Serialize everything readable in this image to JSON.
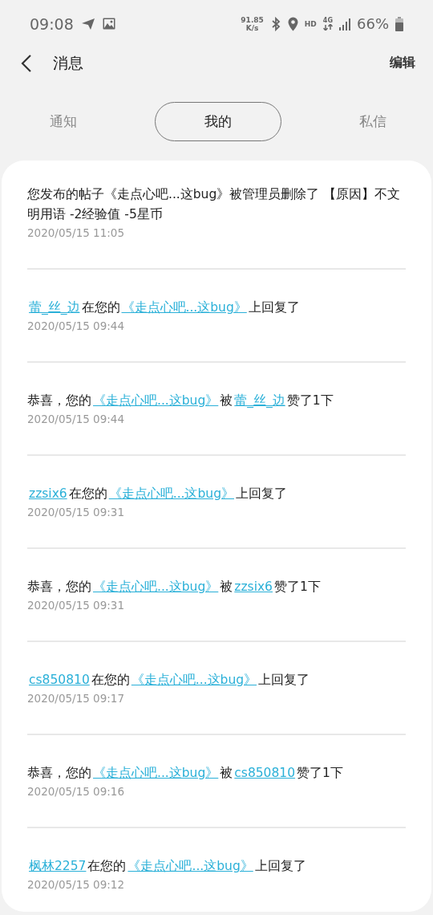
{
  "status_bar": {
    "time": "09:08",
    "speed_value": "91.85",
    "speed_unit": "K/s",
    "hd": "HD",
    "network": "4G",
    "battery": "66%"
  },
  "header": {
    "title": "消息",
    "action": "编辑"
  },
  "tabs": [
    {
      "label": "通知",
      "selected": false
    },
    {
      "label": "我的",
      "selected": true
    },
    {
      "label": "私信",
      "selected": false
    }
  ],
  "messages": [
    {
      "parts": [
        {
          "kind": "text",
          "text": "您发布的帖子《走点心吧...这bug》被管理员删除了 【原因】不文明用语 -2经验值 -5星币"
        }
      ],
      "date": "2020/05/15 11:05"
    },
    {
      "parts": [
        {
          "kind": "link",
          "text": "蕾_丝_边"
        },
        {
          "kind": "text",
          "text": "在您的"
        },
        {
          "kind": "link",
          "text": "《走点心吧...这bug》"
        },
        {
          "kind": "text",
          "text": "上回复了"
        }
      ],
      "date": "2020/05/15 09:44"
    },
    {
      "parts": [
        {
          "kind": "text",
          "text": "恭喜，您的"
        },
        {
          "kind": "link",
          "text": "《走点心吧...这bug》"
        },
        {
          "kind": "text",
          "text": "被"
        },
        {
          "kind": "link",
          "text": "蕾_丝_边"
        },
        {
          "kind": "text",
          "text": "赞了1下"
        }
      ],
      "date": "2020/05/15 09:44"
    },
    {
      "parts": [
        {
          "kind": "link",
          "text": "zzsix6"
        },
        {
          "kind": "text",
          "text": "在您的"
        },
        {
          "kind": "link",
          "text": "《走点心吧...这bug》"
        },
        {
          "kind": "text",
          "text": "上回复了"
        }
      ],
      "date": "2020/05/15 09:31"
    },
    {
      "parts": [
        {
          "kind": "text",
          "text": "恭喜，您的"
        },
        {
          "kind": "link",
          "text": "《走点心吧...这bug》"
        },
        {
          "kind": "text",
          "text": "被"
        },
        {
          "kind": "link",
          "text": "zzsix6"
        },
        {
          "kind": "text",
          "text": "赞了1下"
        }
      ],
      "date": "2020/05/15 09:31"
    },
    {
      "parts": [
        {
          "kind": "link",
          "text": "cs850810"
        },
        {
          "kind": "text",
          "text": "在您的"
        },
        {
          "kind": "link",
          "text": "《走点心吧...这bug》"
        },
        {
          "kind": "text",
          "text": "上回复了"
        }
      ],
      "date": "2020/05/15 09:17"
    },
    {
      "parts": [
        {
          "kind": "text",
          "text": "恭喜，您的"
        },
        {
          "kind": "link",
          "text": "《走点心吧...这bug》"
        },
        {
          "kind": "text",
          "text": "被"
        },
        {
          "kind": "link",
          "text": "cs850810"
        },
        {
          "kind": "text",
          "text": "赞了1下"
        }
      ],
      "date": "2020/05/15 09:16"
    },
    {
      "parts": [
        {
          "kind": "link",
          "text": "枫林2257"
        },
        {
          "kind": "text",
          "text": "在您的"
        },
        {
          "kind": "link",
          "text": "《走点心吧...这bug》"
        },
        {
          "kind": "text",
          "text": "上回复了"
        }
      ],
      "date": "2020/05/15 09:12"
    }
  ]
}
